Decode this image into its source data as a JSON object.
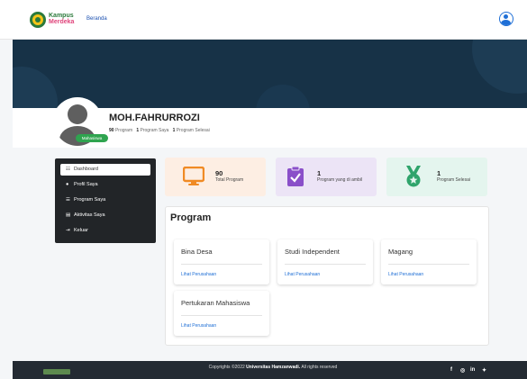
{
  "header": {
    "logo_line1": "Kampus",
    "logo_line2": "Merdeka",
    "nav_beranda": "Beranda"
  },
  "profile": {
    "name": "MOH.FAHRURROZI",
    "role_badge": "Mahasiswa",
    "total_program_count": "90",
    "total_program_label": "Program",
    "my_program_count": "1",
    "my_program_label": "Program Saya",
    "finished_program_count": "1",
    "finished_program_label": "Program Selesai"
  },
  "sidebar": {
    "items": [
      {
        "label": "Dashboard",
        "icon": "dashboard-icon",
        "active": true
      },
      {
        "label": "Profil Saya",
        "icon": "user-icon"
      },
      {
        "label": "Program Saya",
        "icon": "list-icon"
      },
      {
        "label": "Aktivitas Saya",
        "icon": "document-icon"
      },
      {
        "label": "Keluar",
        "icon": "logout-icon"
      }
    ]
  },
  "stats": [
    {
      "value": "90",
      "label": "Total Program",
      "bg": "#fdeee3",
      "accent": "#f08a24",
      "icon": "monitor-icon"
    },
    {
      "value": "1",
      "label": "Program yang di ambil",
      "bg": "#ece4f6",
      "accent": "#8a4fc9",
      "icon": "clipboard-check-icon"
    },
    {
      "value": "1",
      "label": "Program Selesai",
      "bg": "#e4f5ee",
      "accent": "#2fa46b",
      "icon": "medal-icon"
    }
  ],
  "program": {
    "title": "Program",
    "cards": [
      {
        "title": "Bina Desa",
        "link": "Lihat Perusahaan"
      },
      {
        "title": "Studi Independent",
        "link": "Lihat Perusahaan"
      },
      {
        "title": "Magang",
        "link": "Lihat Perusahaan"
      },
      {
        "title": "Pertukaran Mahasiswa",
        "link": "Lihat Perusahaan"
      }
    ]
  },
  "footer": {
    "copyright_prefix": "Copyrights ©2022",
    "copyright_org": "Universitas Hamzanwadi.",
    "copyright_suffix": "All rights reserved",
    "social": [
      "facebook-icon",
      "instagram-icon",
      "linkedin-icon",
      "twitter-icon"
    ]
  }
}
